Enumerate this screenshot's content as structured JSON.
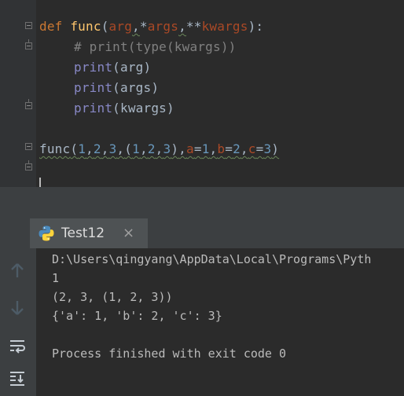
{
  "editor": {
    "line1": {
      "kw": "def",
      "name": "func",
      "open": "(",
      "arg": "arg",
      "sep1": ",",
      "star": "*",
      "args": "args",
      "sep2": ",",
      "dstar": "**",
      "kwargs": "kwargs",
      "close": "):"
    },
    "line2": {
      "comment": "# print(type(kwargs))"
    },
    "line3": {
      "fn": "print",
      "rest": "(arg)"
    },
    "line4": {
      "fn": "print",
      "rest": "(args)"
    },
    "line5": {
      "fn": "print",
      "rest": "(kwargs)"
    },
    "line6": {
      "name": "func",
      "open": "(",
      "n1": "1",
      "c1": ",",
      "n2": "2",
      "c2": ",",
      "n3": "3",
      "c3": ",",
      "tup_open": "(",
      "t1": "1",
      "tc1": ",",
      "t2": "2",
      "tc2": ",",
      "t3": "3",
      "tup_close": ")",
      "c4": ",",
      "pa": "a",
      "eq1": "=",
      "va": "1",
      "c5": ",",
      "pb": "b",
      "eq2": "=",
      "vb": "2",
      "c6": ",",
      "pc": "c",
      "eq3": "=",
      "vc": "3",
      "close": ")"
    }
  },
  "run_tab": {
    "title": "Test12",
    "close": "×",
    "icon": "python-icon"
  },
  "toolbar": {
    "icons": [
      "arrow-up-icon",
      "arrow-down-icon",
      "soft-wrap-icon",
      "scroll-to-end-icon"
    ]
  },
  "console": {
    "lines": [
      "D:\\Users\\qingyang\\AppData\\Local\\Programs\\Pyth",
      "1",
      "(2, 3, (1, 2, 3))",
      "{'a': 1, 'b': 2, 'c': 3}",
      "",
      "Process finished with exit code 0"
    ]
  },
  "colors": {
    "editor_bg": "#2b2b2b",
    "keyword": "#cc7832",
    "function": "#ffc66d",
    "number": "#6897bb",
    "builtin": "#8888c6",
    "comment": "#808080",
    "param": "#aa4926"
  }
}
